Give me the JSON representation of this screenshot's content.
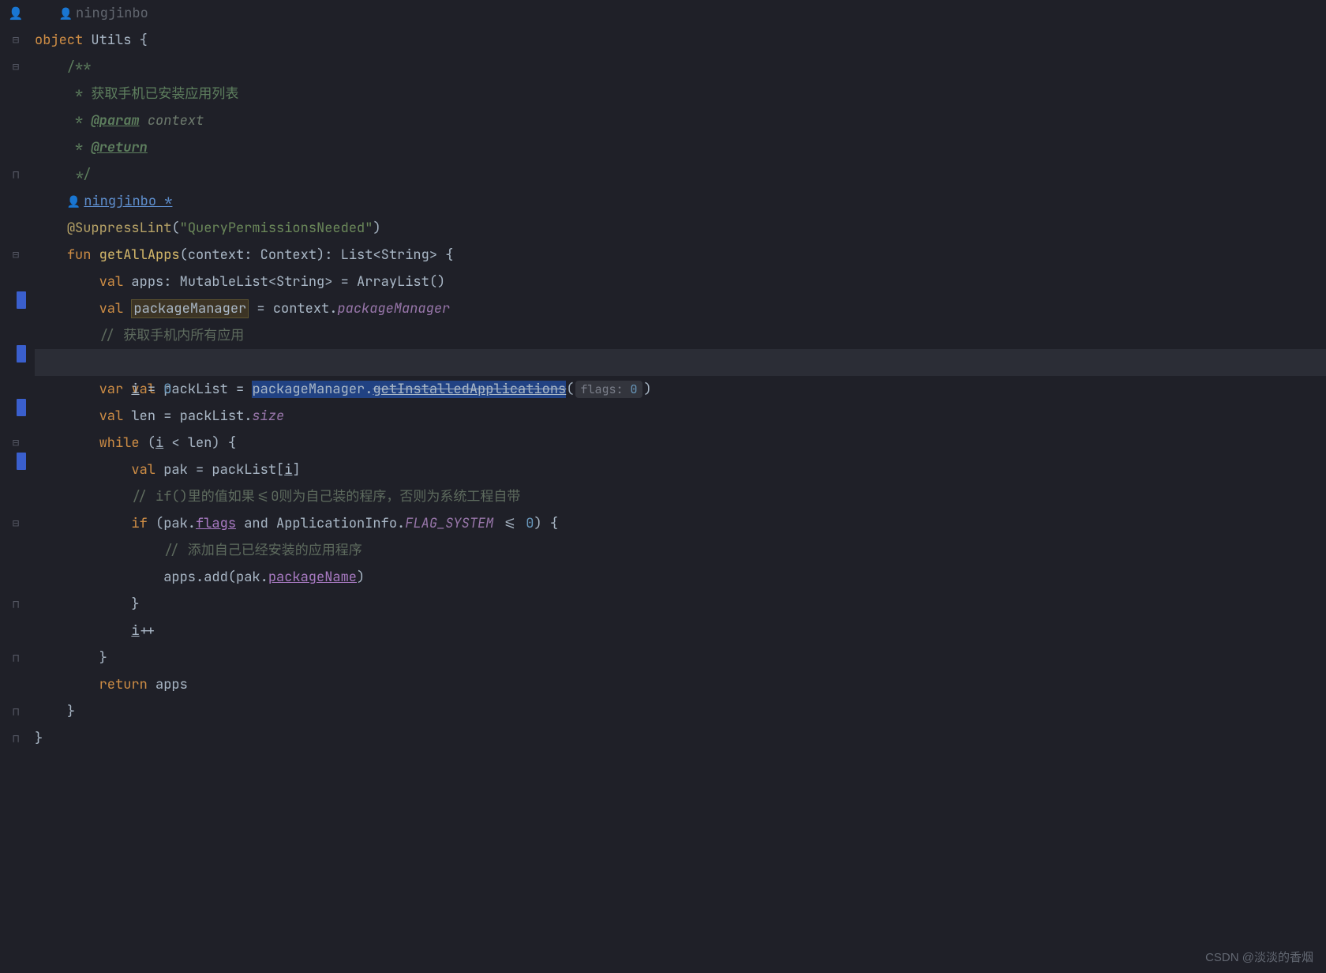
{
  "top_author": "ningjinbo",
  "author_link": "ningjinbo *",
  "watermark": "CSDN @淡淡的香烟",
  "code": {
    "object_kw": "object",
    "object_name": "Utils",
    "brace_open": "{",
    "doc_open": "/**",
    "doc_line1_prefix": " * ",
    "doc_line1_text": "获取手机已安装应用列表",
    "doc_line2_prefix": " * ",
    "doc_param_tag": "@param",
    "doc_param_name": "context",
    "doc_line3_prefix": " * ",
    "doc_return_tag": "@return",
    "doc_close": " */",
    "annotation_at": "@SuppressLint",
    "annotation_args": "(\"QueryPermissionsNeeded\")",
    "annotation_str": "QueryPermissionsNeeded",
    "fun_kw": "fun",
    "fun_name": "getAllApps",
    "fun_sig_open": "(context: Context): List<String> {",
    "val_kw": "val",
    "var_kw": "var",
    "apps_decl": "apps: MutableList<String> = ArrayList()",
    "pm_var": "packageManager",
    "pm_assign": " = context.",
    "pm_prop": "packageManager",
    "comment_all_apps": "// 获取手机内所有应用",
    "packlist_lhs": "packList = ",
    "packlist_rhs_obj": "packageManager",
    "packlist_dot": ".",
    "packlist_method": "getInstalledApplications",
    "packlist_paren_open": "(",
    "hint_label": "flags:",
    "hint_value": "0",
    "packlist_paren_close": ")",
    "i_decl": "i",
    "i_eq": " = ",
    "i_zero": "0",
    "len_decl": "len = packList.",
    "size_prop": "size",
    "while_kw": "while",
    "while_cond_open": " (",
    "while_cond_i": "i",
    "while_cond_rest": " < len) {",
    "pak_decl": "pak = packList[",
    "pak_idx": "i",
    "pak_close": "]",
    "comment_if_note": "// if()里的值如果<=0则为自己装的程序，否则为系统工程自带",
    "if_kw": "if",
    "if_open": " (pak.",
    "flags_prop": "flags",
    "if_mid": " and ApplicationInfo.",
    "flag_system": "FLAG_SYSTEM",
    "if_cmp": " <= ",
    "if_zero": "0",
    "if_close": ") {",
    "comment_add": "// 添加自己已经安装的应用程序",
    "apps_add_pre": "apps.add(pak.",
    "packageName_prop": "packageName",
    "apps_add_post": ")",
    "brace_close": "}",
    "i_inc": "i",
    "i_inc_op": "++",
    "return_kw": "return",
    "return_val": " apps"
  }
}
